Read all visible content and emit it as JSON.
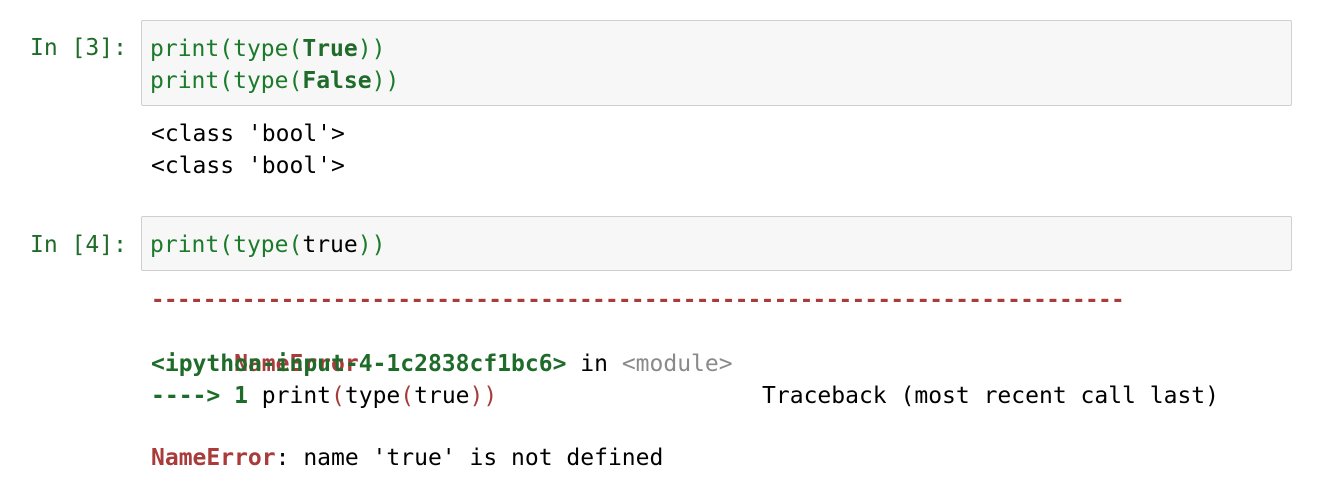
{
  "cells": [
    {
      "prompt": "In [3]:",
      "code": [
        {
          "fn1": "print",
          "p1": "(",
          "fn2": "type",
          "p2": "(",
          "arg": "True",
          "p3": ")",
          "p4": ")"
        },
        {
          "fn1": "print",
          "p1": "(",
          "fn2": "type",
          "p2": "(",
          "arg": "False",
          "p3": ")",
          "p4": ")"
        }
      ],
      "output": [
        "<class 'bool'>",
        "<class 'bool'>"
      ]
    },
    {
      "prompt": "In [4]:",
      "code": [
        {
          "fn1": "print",
          "p1": "(",
          "fn2": "type",
          "p2": "(",
          "arg": "true",
          "p3": ")",
          "p4": ")"
        }
      ],
      "traceback": {
        "dashes": "---------------------------------------------------------------------------",
        "error_name": "NameError",
        "header_right": "Traceback (most recent call last)",
        "input_ref": "<ipython-input-4-1c2838cf1bc6>",
        "in_word": " in ",
        "module": "<module>",
        "arrow": "----> 1 ",
        "line_fn1": "print",
        "line_p1": "(",
        "line_fn2": "type",
        "line_p2": "(",
        "line_arg": "true",
        "line_p3": ")",
        "line_p4": ")",
        "final_error": "NameError",
        "final_msg": ": name 'true' is not defined"
      }
    }
  ]
}
